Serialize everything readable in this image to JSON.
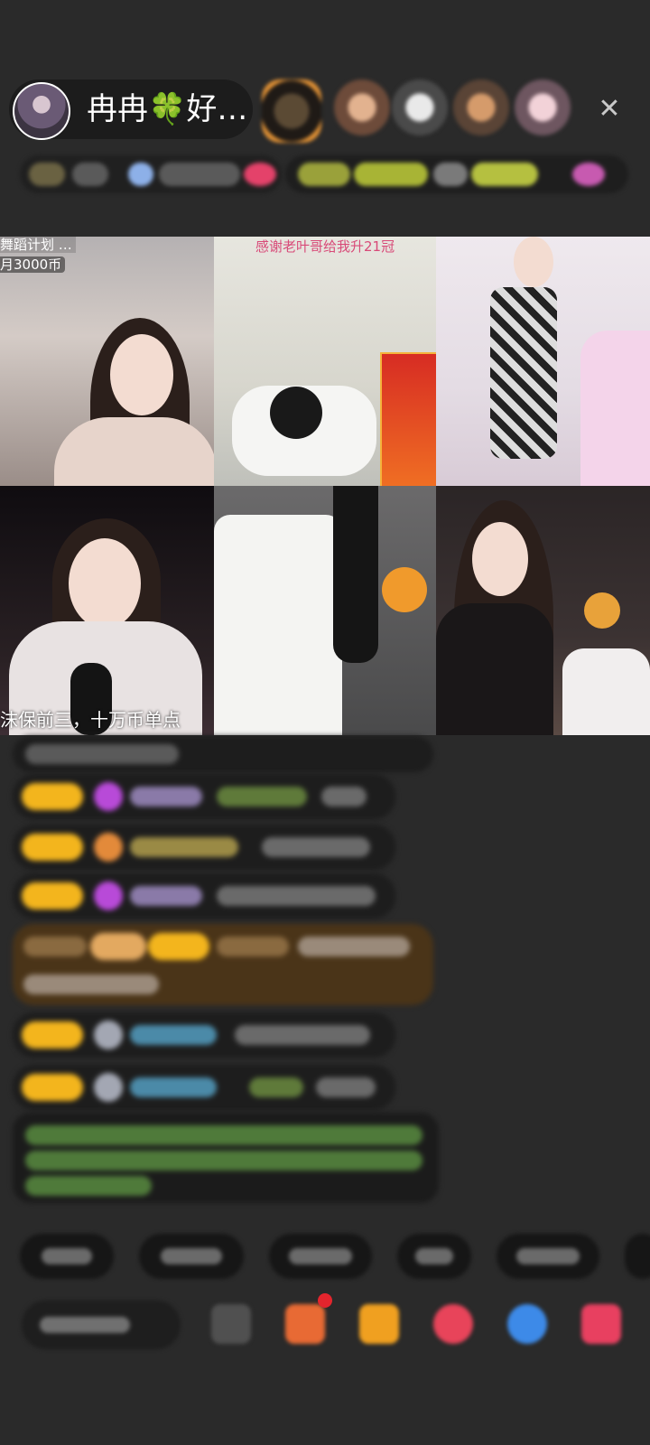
{
  "host": {
    "name": "冉冉🍀好…"
  },
  "top_bar": {
    "viewers_count": 5,
    "close_icon": "close-icon"
  },
  "grid": {
    "tiles": [
      {
        "caption_lines": [
          "舞蹈计划 …",
          "月3000币"
        ]
      },
      {
        "caption_lines": [
          "感谢老叶哥给我升21冠"
        ]
      },
      {
        "caption_lines": []
      },
      {
        "caption_lines": [
          "沫保前三，十万币单点"
        ]
      },
      {
        "caption_lines": []
      },
      {
        "caption_lines": []
      }
    ]
  },
  "colors": {
    "background": "#2a2a2a",
    "badge_gold": "#f3b51d",
    "bubble": "#1d1d1d"
  }
}
